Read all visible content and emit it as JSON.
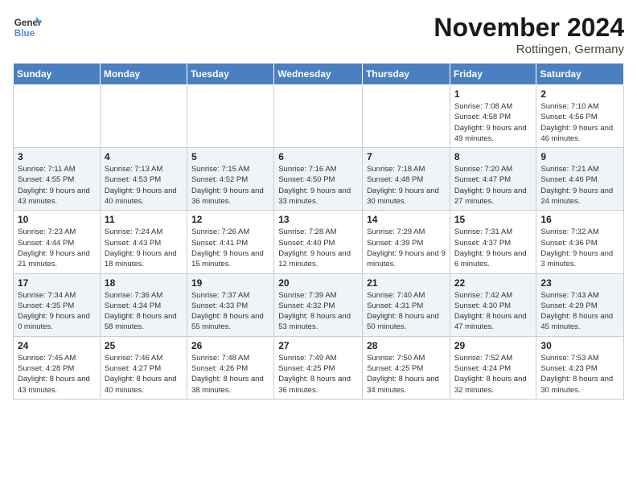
{
  "header": {
    "logo_general": "General",
    "logo_blue": "Blue",
    "month_title": "November 2024",
    "location": "Rottingen, Germany"
  },
  "weekdays": [
    "Sunday",
    "Monday",
    "Tuesday",
    "Wednesday",
    "Thursday",
    "Friday",
    "Saturday"
  ],
  "weeks": [
    [
      {
        "day": "",
        "info": ""
      },
      {
        "day": "",
        "info": ""
      },
      {
        "day": "",
        "info": ""
      },
      {
        "day": "",
        "info": ""
      },
      {
        "day": "",
        "info": ""
      },
      {
        "day": "1",
        "info": "Sunrise: 7:08 AM\nSunset: 4:58 PM\nDaylight: 9 hours and 49 minutes."
      },
      {
        "day": "2",
        "info": "Sunrise: 7:10 AM\nSunset: 4:56 PM\nDaylight: 9 hours and 46 minutes."
      }
    ],
    [
      {
        "day": "3",
        "info": "Sunrise: 7:11 AM\nSunset: 4:55 PM\nDaylight: 9 hours and 43 minutes."
      },
      {
        "day": "4",
        "info": "Sunrise: 7:13 AM\nSunset: 4:53 PM\nDaylight: 9 hours and 40 minutes."
      },
      {
        "day": "5",
        "info": "Sunrise: 7:15 AM\nSunset: 4:52 PM\nDaylight: 9 hours and 36 minutes."
      },
      {
        "day": "6",
        "info": "Sunrise: 7:16 AM\nSunset: 4:50 PM\nDaylight: 9 hours and 33 minutes."
      },
      {
        "day": "7",
        "info": "Sunrise: 7:18 AM\nSunset: 4:48 PM\nDaylight: 9 hours and 30 minutes."
      },
      {
        "day": "8",
        "info": "Sunrise: 7:20 AM\nSunset: 4:47 PM\nDaylight: 9 hours and 27 minutes."
      },
      {
        "day": "9",
        "info": "Sunrise: 7:21 AM\nSunset: 4:46 PM\nDaylight: 9 hours and 24 minutes."
      }
    ],
    [
      {
        "day": "10",
        "info": "Sunrise: 7:23 AM\nSunset: 4:44 PM\nDaylight: 9 hours and 21 minutes."
      },
      {
        "day": "11",
        "info": "Sunrise: 7:24 AM\nSunset: 4:43 PM\nDaylight: 9 hours and 18 minutes."
      },
      {
        "day": "12",
        "info": "Sunrise: 7:26 AM\nSunset: 4:41 PM\nDaylight: 9 hours and 15 minutes."
      },
      {
        "day": "13",
        "info": "Sunrise: 7:28 AM\nSunset: 4:40 PM\nDaylight: 9 hours and 12 minutes."
      },
      {
        "day": "14",
        "info": "Sunrise: 7:29 AM\nSunset: 4:39 PM\nDaylight: 9 hours and 9 minutes."
      },
      {
        "day": "15",
        "info": "Sunrise: 7:31 AM\nSunset: 4:37 PM\nDaylight: 9 hours and 6 minutes."
      },
      {
        "day": "16",
        "info": "Sunrise: 7:32 AM\nSunset: 4:36 PM\nDaylight: 9 hours and 3 minutes."
      }
    ],
    [
      {
        "day": "17",
        "info": "Sunrise: 7:34 AM\nSunset: 4:35 PM\nDaylight: 9 hours and 0 minutes."
      },
      {
        "day": "18",
        "info": "Sunrise: 7:36 AM\nSunset: 4:34 PM\nDaylight: 8 hours and 58 minutes."
      },
      {
        "day": "19",
        "info": "Sunrise: 7:37 AM\nSunset: 4:33 PM\nDaylight: 8 hours and 55 minutes."
      },
      {
        "day": "20",
        "info": "Sunrise: 7:39 AM\nSunset: 4:32 PM\nDaylight: 8 hours and 53 minutes."
      },
      {
        "day": "21",
        "info": "Sunrise: 7:40 AM\nSunset: 4:31 PM\nDaylight: 8 hours and 50 minutes."
      },
      {
        "day": "22",
        "info": "Sunrise: 7:42 AM\nSunset: 4:30 PM\nDaylight: 8 hours and 47 minutes."
      },
      {
        "day": "23",
        "info": "Sunrise: 7:43 AM\nSunset: 4:29 PM\nDaylight: 8 hours and 45 minutes."
      }
    ],
    [
      {
        "day": "24",
        "info": "Sunrise: 7:45 AM\nSunset: 4:28 PM\nDaylight: 8 hours and 43 minutes."
      },
      {
        "day": "25",
        "info": "Sunrise: 7:46 AM\nSunset: 4:27 PM\nDaylight: 8 hours and 40 minutes."
      },
      {
        "day": "26",
        "info": "Sunrise: 7:48 AM\nSunset: 4:26 PM\nDaylight: 8 hours and 38 minutes."
      },
      {
        "day": "27",
        "info": "Sunrise: 7:49 AM\nSunset: 4:25 PM\nDaylight: 8 hours and 36 minutes."
      },
      {
        "day": "28",
        "info": "Sunrise: 7:50 AM\nSunset: 4:25 PM\nDaylight: 8 hours and 34 minutes."
      },
      {
        "day": "29",
        "info": "Sunrise: 7:52 AM\nSunset: 4:24 PM\nDaylight: 8 hours and 32 minutes."
      },
      {
        "day": "30",
        "info": "Sunrise: 7:53 AM\nSunset: 4:23 PM\nDaylight: 8 hours and 30 minutes."
      }
    ]
  ]
}
